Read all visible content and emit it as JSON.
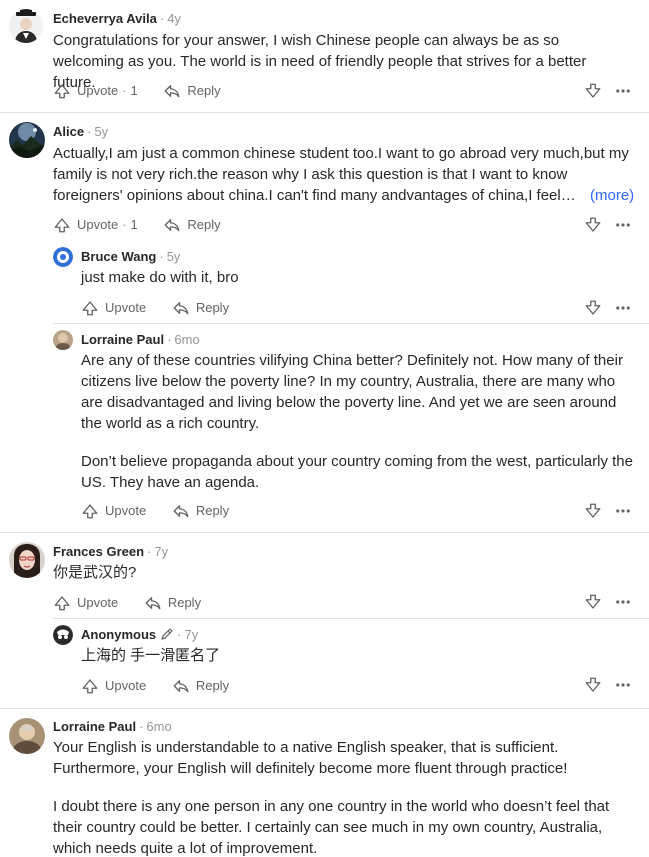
{
  "labels": {
    "upvote": "Upvote",
    "reply": "Reply",
    "more": "(more)",
    "dot": "·"
  },
  "comments": [
    {
      "name": "Echeverrya Avila",
      "time": "4y",
      "text": "Congratulations for your answer, I wish Chinese people can always be as so welcoming as you. The world is in need of friendly people that strives for a better future.",
      "upvotes": "1"
    },
    {
      "name": "Alice",
      "time": "5y",
      "text": "Actually,I am just a common chinese student too.I want to go abroad very much,but my family is not very rich.the reason why I ask this question is that I want to know foreigners' opinions about china.I can't find many andvantages of china,I feel…",
      "upvotes": "1"
    },
    {
      "name": "Bruce Wang",
      "time": "5y",
      "text": "just make do with it, bro"
    },
    {
      "name": "Lorraine Paul",
      "time": "6mo",
      "paragraph1": "Are any of these countries vilifying China better? Definitely not. How many of their citizens live below the poverty line? In my country, Australia, there are many who are disadvantaged and living below the poverty line. And yet we are seen around the world as a rich country.",
      "paragraph2": "Don’t believe propaganda about your country coming from the west, particularly the US. They have an agenda."
    },
    {
      "name": "Frances Green",
      "time": "7y",
      "text": "你是武汉的?"
    },
    {
      "name": "Anonymous",
      "time": "7y",
      "text": "上海的 手一滑匿名了"
    },
    {
      "name": "Lorraine Paul",
      "time": "6mo",
      "paragraph1": "Your English is understandable to a native English speaker, that is sufficient. Furthermore, your English will definitely become more fluent through practice!",
      "paragraph2": "I doubt there is any one person in any one country in the world who doesn’t feel that their country could be better. I certainly can see much in my own country, Australia, which needs quite a lot of improvement."
    }
  ],
  "colors": {
    "text": "#282829",
    "muted": "#636466",
    "link": "#2e69ff",
    "divider": "#dee0e1"
  },
  "icons": [
    "upvote-arrow-icon",
    "reply-arrow-icon",
    "downvote-arrow-icon",
    "more-dots-icon",
    "pencil-icon"
  ]
}
